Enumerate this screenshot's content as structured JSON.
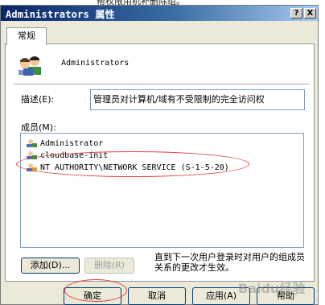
{
  "top_caption": "帮权限用机补删除组。",
  "window": {
    "title": "Administrators 属性",
    "help_btn": "?",
    "close_btn": "X"
  },
  "tab": {
    "label": "常规"
  },
  "group": {
    "name": "Administrators"
  },
  "description": {
    "label": "描述(E):",
    "value": "管理员对计算机/域有不受限制的完全访问权"
  },
  "members": {
    "label": "成员(M):",
    "items": [
      {
        "name": "Administrator"
      },
      {
        "name": "cloudbase-init"
      },
      {
        "name": "NT AUTHORITY\\NETWORK SERVICE (S-1-5-20)"
      }
    ]
  },
  "buttons": {
    "add": "添加(D)...",
    "remove": "删除(R)",
    "ok": "确定",
    "cancel": "取消",
    "apply": "应用(A)",
    "help": "帮助"
  },
  "note": "直到下一次用户登录时对用户的组成员关系的更改才生效。",
  "watermark": "Baidu经验",
  "colors": {
    "titlebar_start": "#0a246a",
    "dialog_bg": "#ece9d8",
    "highlight_ellipse": "#e23b3b"
  },
  "icons": [
    "group-icon",
    "user-icon"
  ]
}
